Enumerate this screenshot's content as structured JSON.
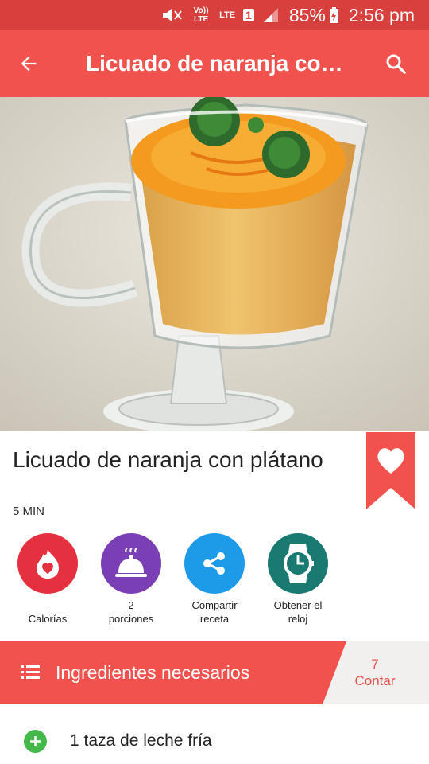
{
  "status_bar": {
    "network_label": "Vo)) LTE",
    "lte_label": "LTE",
    "sim_number": "1",
    "battery": "85%",
    "time": "2:56 pm"
  },
  "app_bar": {
    "title": "Licuado de naranja con…"
  },
  "recipe": {
    "title": "Licuado de naranja con plátano",
    "time": "5 MIN"
  },
  "actions": [
    {
      "label": "-\nCalorías",
      "icon": "flame-heart-icon",
      "color": "#e5313f"
    },
    {
      "label": "2\nporciones",
      "icon": "cloche-icon",
      "color": "#7b3fb5"
    },
    {
      "label": "Compartir\nreceta",
      "icon": "share-icon",
      "color": "#1e9be8"
    },
    {
      "label": "Obtener el\nreloj",
      "icon": "watch-icon",
      "color": "#1a7a72"
    }
  ],
  "ingredients": {
    "header": "Ingredientes necesarios",
    "count_value": "7",
    "count_label": "Contar",
    "items": [
      "1 taza de leche fría"
    ]
  },
  "colors": {
    "primary": "#f2524d",
    "status_bar": "#d8403d",
    "add_green": "#44b84a"
  }
}
